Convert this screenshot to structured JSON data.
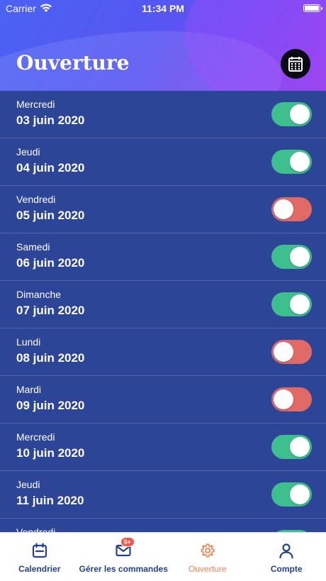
{
  "status_bar": {
    "carrier": "Carrier",
    "time": "11:34 PM"
  },
  "header": {
    "title": "Ouverture",
    "calendar_icon": "calendar-grid-icon"
  },
  "days": [
    {
      "day": "Mercredi",
      "date": "03 juin 2020",
      "open": true
    },
    {
      "day": "Jeudi",
      "date": "04 juin 2020",
      "open": true
    },
    {
      "day": "Vendredi",
      "date": "05 juin 2020",
      "open": false
    },
    {
      "day": "Samedi",
      "date": "06 juin 2020",
      "open": true
    },
    {
      "day": "Dimanche",
      "date": "07 juin 2020",
      "open": true
    },
    {
      "day": "Lundi",
      "date": "08 juin 2020",
      "open": false
    },
    {
      "day": "Mardi",
      "date": "09 juin 2020",
      "open": false
    },
    {
      "day": "Mercredi",
      "date": "10 juin 2020",
      "open": true
    },
    {
      "day": "Jeudi",
      "date": "11 juin 2020",
      "open": true
    },
    {
      "day": "Vendredi",
      "date": "",
      "open": true
    }
  ],
  "colors": {
    "on": "#3ec08e",
    "off": "#e26a66",
    "active_tab": "#ef8454",
    "tab": "#25418c"
  },
  "tabs": [
    {
      "label": "Calendrier",
      "icon": "calendar-icon"
    },
    {
      "label": "Gérer les commandes",
      "icon": "mail-icon",
      "badge": "6+"
    },
    {
      "label": "Ouverture",
      "icon": "gear-icon",
      "active": true
    },
    {
      "label": "Compte",
      "icon": "user-icon"
    }
  ]
}
